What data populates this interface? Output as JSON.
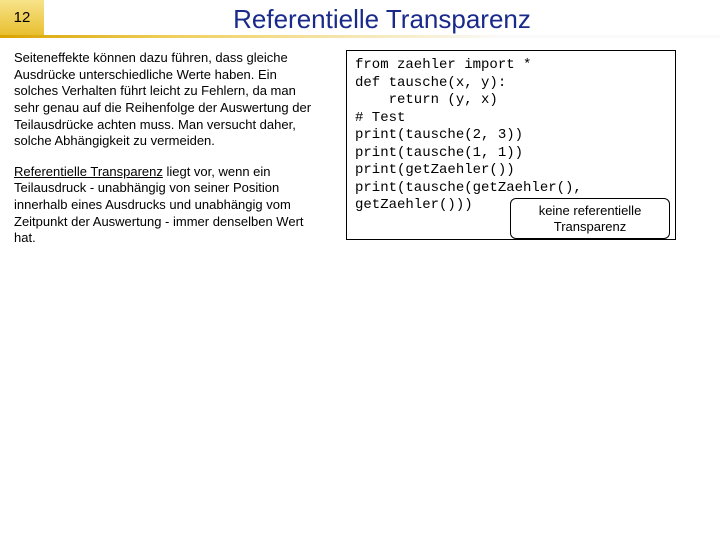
{
  "slide_number": "12",
  "title": "Referentielle Transparenz",
  "left": {
    "p1": "Seiteneffekte können dazu führen, dass gleiche Ausdrücke unterschiedliche Werte haben. Ein solches Verhalten führt leicht zu Fehlern, da man sehr genau auf die Reihenfolge der Auswertung der Teilausdrücke achten muss. Man versucht daher, solche Abhängigkeit zu vermeiden.",
    "p2_term": "Referentielle Transparenz",
    "p2_rest": " liegt vor, wenn ein Teilausdruck - unabhängig von seiner Position innerhalb eines Ausdrucks und unabhängig vom Zeitpunkt der Auswertung - immer denselben Wert hat."
  },
  "code": {
    "l1": "from zaehler import *",
    "l2": "def tausche(x, y):",
    "l3": "    return (y, x)",
    "l4": "# Test",
    "l5": "print(tausche(2, 3))",
    "l6": "print(tausche(1, 1))",
    "l7": "print(getZaehler())",
    "l8": "print(tausche(getZaehler(),",
    "l9": "getZaehler()))"
  },
  "note": "keine referentielle Transparenz"
}
